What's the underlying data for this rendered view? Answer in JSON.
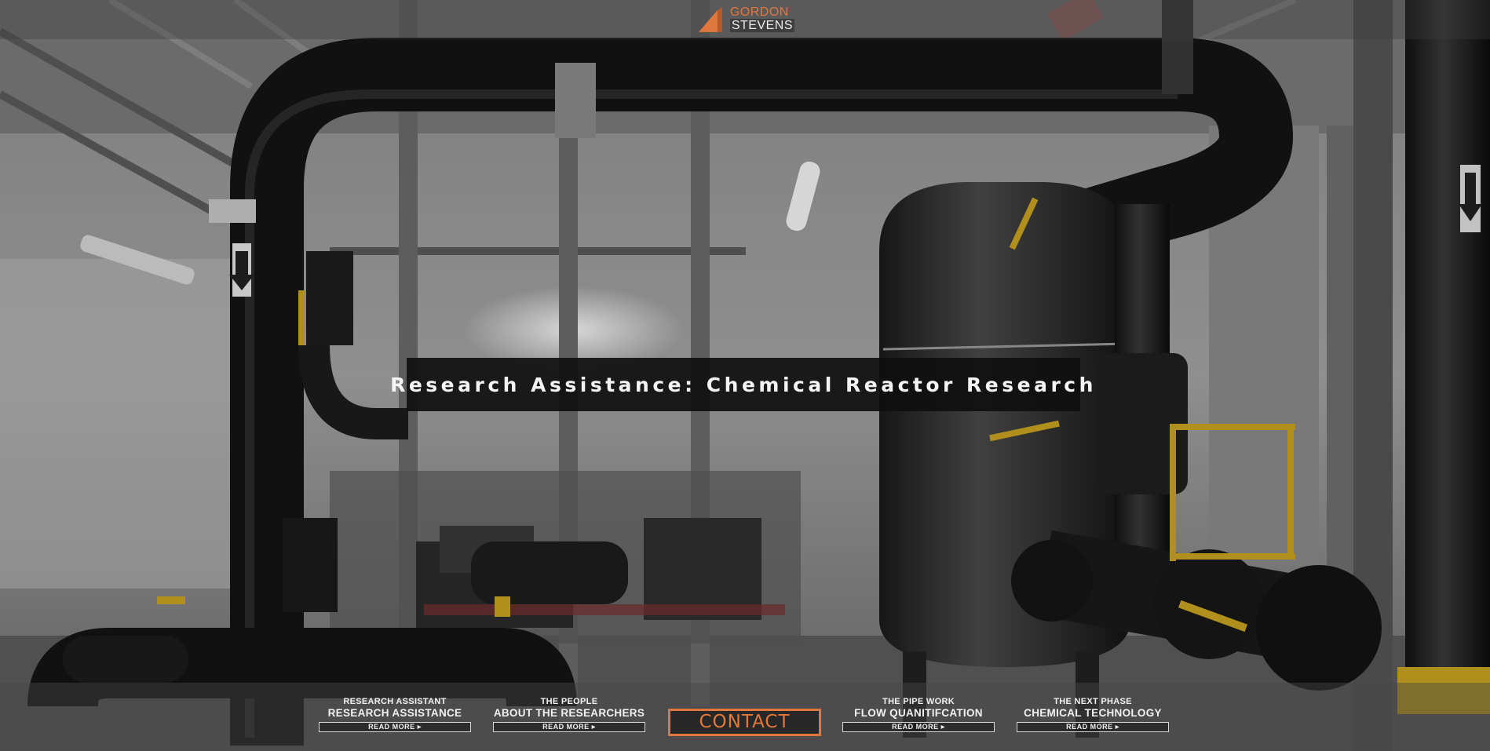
{
  "brand": {
    "logo_icon": "triangle-logo-icon",
    "name_line1": "GORDON",
    "name_line2": "STEVENS",
    "accent_color": "#e0783e"
  },
  "hero": {
    "title": "Research Assistance: Chemical Reactor Research"
  },
  "nav": {
    "items": [
      {
        "kicker": "RESEARCH ASSISTANT",
        "title": "RESEARCH ASSISTANCE",
        "link": "READ MORE"
      },
      {
        "kicker": "THE PEOPLE",
        "title": "ABOUT THE RESEARCHERS",
        "link": "READ MORE"
      },
      {
        "kicker": "THE PIPE WORK",
        "title": "FLOW QUANITIFCATION",
        "link": "READ MORE"
      },
      {
        "kicker": "THE NEXT PHASE",
        "title": "CHEMICAL TECHNOLOGY",
        "link": "READ MORE"
      }
    ],
    "contact_label": "CONTACT"
  }
}
